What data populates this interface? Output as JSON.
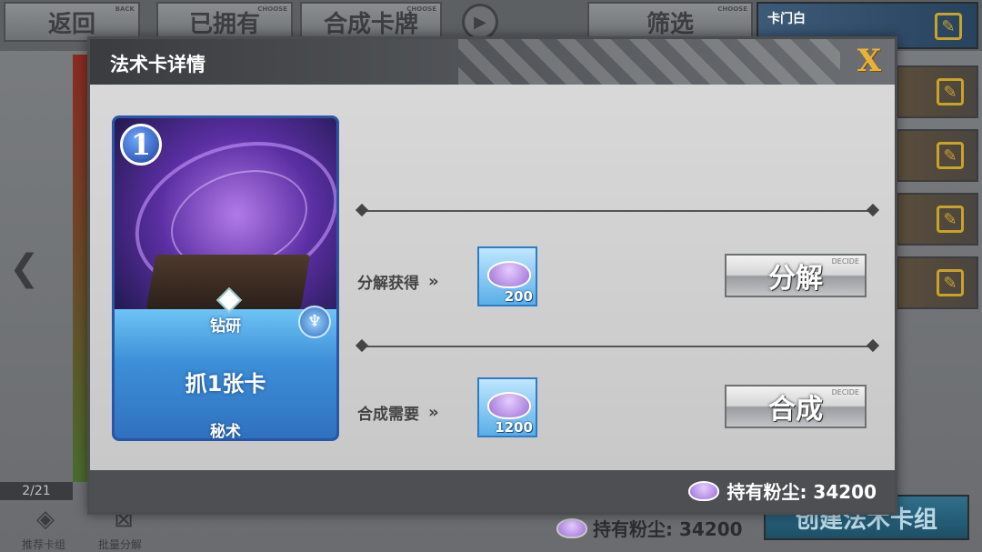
{
  "background": {
    "top_buttons": {
      "back": "返回",
      "back_small": "BACK",
      "owned": "已拥有",
      "owned_small": "CHOOSE",
      "craft": "合成卡牌",
      "craft_small": "CHOOSE",
      "filter": "筛选",
      "filter_small": "CHOOSE"
    },
    "deck_title": "卡门白",
    "page_count": "2/21",
    "bottom_left": {
      "recommend_label": "推荐卡组",
      "batch_label": "批量分解"
    },
    "dust_owned_label": "持有粉尘: 34200",
    "create_button": "创建法术卡组"
  },
  "modal": {
    "title": "法术卡详情",
    "close_label": "X",
    "card": {
      "cost": "1",
      "type": "钻研",
      "effect": "抓1张卡",
      "class": "秘术"
    },
    "disenchant": {
      "label": "分解获得",
      "chevrons": "»",
      "amount": "200",
      "button_label": "分解",
      "button_small": "DECIDE"
    },
    "craft": {
      "label": "合成需要",
      "chevrons": "»",
      "amount": "1200",
      "button_label": "合成",
      "button_small": "DECIDE"
    },
    "footer": {
      "dust_owned": "持有粉尘: 34200"
    }
  },
  "colors": {
    "accent_gold": "#e8b23a",
    "card_blue": "#2f6fbd",
    "dust_purple": "#9a6fd4"
  }
}
